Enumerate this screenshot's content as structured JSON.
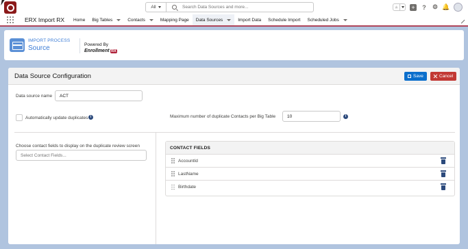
{
  "header": {
    "search_scope": "All",
    "search_placeholder": "Search Data Sources and more..."
  },
  "nav": {
    "app_name": "ERX Import RX",
    "items": [
      {
        "label": "Home",
        "dropdown": false
      },
      {
        "label": "Big Tables",
        "dropdown": true
      },
      {
        "label": "Contacts",
        "dropdown": true
      },
      {
        "label": "Mapping Page",
        "dropdown": false
      },
      {
        "label": "Data Sources",
        "dropdown": true,
        "active": true
      },
      {
        "label": "Import Data",
        "dropdown": false
      },
      {
        "label": "Schedule Import",
        "dropdown": false
      },
      {
        "label": "Scheduled Jobs",
        "dropdown": true
      }
    ]
  },
  "page_header": {
    "eyebrow": "IMPORT PROCESS",
    "title": "Source",
    "powered_by": "Powered By",
    "brand_text": "Enrollment",
    "brand_badge": "RX"
  },
  "form": {
    "title": "Data Source Configuration",
    "save_label": "Save",
    "cancel_label": "Cancel",
    "name_label": "Data source name",
    "name_value": "ACT",
    "auto_update_label": "Automatically update duplicates",
    "max_dup_label": "Maximum number of duplicate Contacts per Big Table",
    "max_dup_value": "10",
    "choose_fields_label": "Choose contact fields to display on the duplicate review screen",
    "select_placeholder": "Select Contact Fields..."
  },
  "contact_fields": {
    "header": "CONTACT FIELDS",
    "rows": [
      "AccountId",
      "LastName",
      "Birthdate"
    ]
  },
  "colors": {
    "accent": "#0b6fcc",
    "danger": "#c23934",
    "brand": "#b0455a",
    "page_bg": "#b0c4df"
  }
}
